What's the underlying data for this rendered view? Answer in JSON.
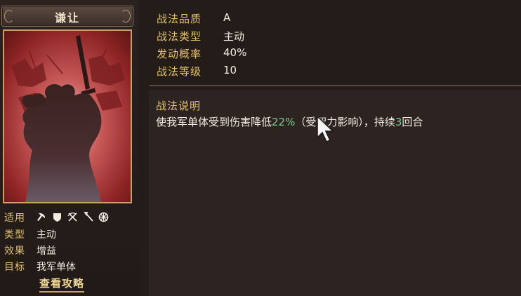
{
  "skill": {
    "name": "谦让",
    "quality_label": "战法品质",
    "quality": "A",
    "type_label": "战法类型",
    "type": "主动",
    "rate_label": "发动概率",
    "rate": "40%",
    "level_label": "战法等级",
    "level": "10"
  },
  "attributes": {
    "applicable_label": "适用",
    "applicable_icons": [
      "axe-icon",
      "shield-icon",
      "crossed-bows-icon",
      "spear-icon",
      "wheel-icon"
    ],
    "category_label": "类型",
    "category": "主动",
    "effect_label": "效果",
    "effect": "增益",
    "target_label": "目标",
    "target": "我军单体"
  },
  "guide_link": "查看攻略",
  "description": {
    "title": "战法说明",
    "text_1": "使我军单体受到伤害降低",
    "value_1": "22%",
    "text_2": "（受智力影响），持续",
    "value_2": "3",
    "text_3": "回合"
  },
  "colors": {
    "label_gold": "#e3c16a",
    "highlight_green": "#77cf8f",
    "portrait_red": "#8a2a2a"
  }
}
